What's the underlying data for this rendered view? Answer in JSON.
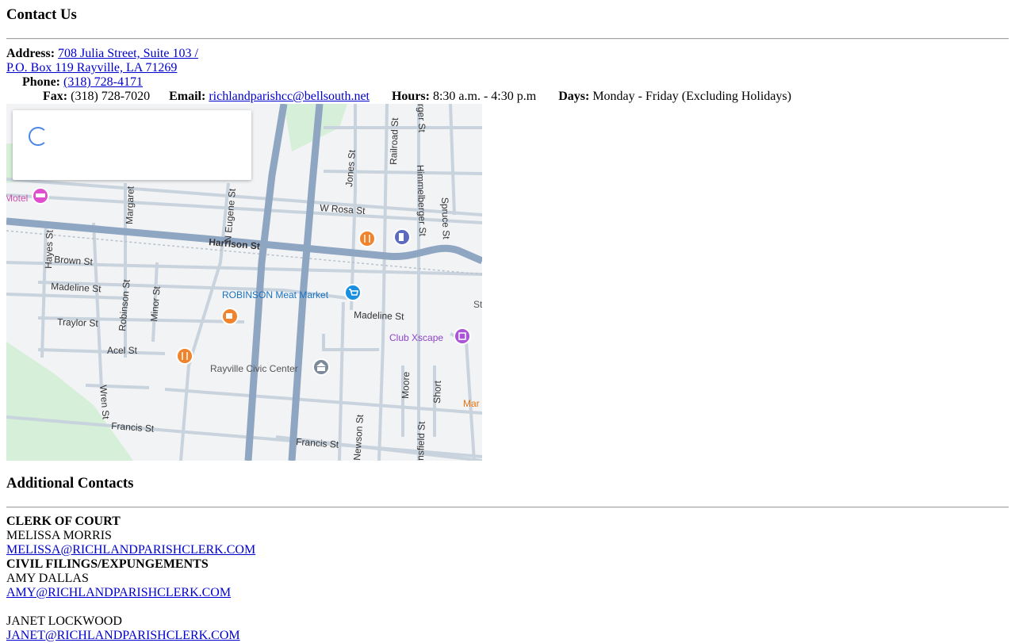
{
  "contact": {
    "title": "Contact Us",
    "address_label": "Address:",
    "address_line1": "708 Julia Street, Suite 103 /",
    "address_line2": "P.O. Box 119 Rayville, LA 71269",
    "phone_label": "Phone:",
    "phone": "(318) 728-4171",
    "fax_label": "Fax:",
    "fax": "(318) 728-7020",
    "email_label": "Email:",
    "email": "richlandparishcc@bellsouth.net",
    "hours_label": "Hours:",
    "hours": "8:30 a.m. - 4:30 p.m",
    "days_label": "Days:",
    "days": "Monday - Friday (Excluding Holidays)"
  },
  "map": {
    "streets": {
      "harrison": "Harrison St",
      "w_rosa": "W Rosa St",
      "brown": "Brown St",
      "madeline_w": "Madeline St",
      "madeline_e": "Madeline St",
      "traylor": "Traylor St",
      "acel": "Acel St",
      "francis_w": "Francis St",
      "francis_e": "Francis St",
      "hayes": "Hayes St",
      "margaret": "Margaret",
      "n_eugene": "N Eugene St",
      "robinson": "Robinson St",
      "minor": "Minor St",
      "wren": "Wren St",
      "jones": "Jones St",
      "railroad": "Railroad St",
      "himmelberger": "Himmelberger St",
      "spruce": "Spruce St",
      "newson": "Newson St",
      "moore": "Moore",
      "short": "Short",
      "mansfield": "nsfield St",
      "burger": "rger St"
    },
    "pois": {
      "motel": "Motel",
      "robinson_market": "ROBINSON Meat Market",
      "club_xscape": "Club Xscape",
      "civic_center": "Rayville Civic Center",
      "mar": "Mar",
      "st_fragment": "St"
    }
  },
  "additional": {
    "title": "Additional Contacts",
    "contacts": [
      {
        "role": "CLERK OF COURT",
        "name": "MELISSA MORRIS",
        "email": "MELISSA@RICHLANDPARISHCLERK.COM"
      },
      {
        "role": "CIVIL FILINGS/EXPUNGEMENTS",
        "name": "AMY DALLAS",
        "email": "AMY@RICHLANDPARISHCLERK.COM"
      },
      {
        "role": "",
        "name": "JANET LOCKWOOD",
        "email": "JANET@RICHLANDPARISHCLERK.COM"
      }
    ]
  },
  "colors": {
    "link": "#0000cc",
    "map_bg": "#f2f3f5",
    "road_major": "#8fa6c2",
    "road_minor": "#c9d3dd",
    "park": "#d6efd8",
    "poi_food": "#f0832b",
    "poi_purple": "#a855d6",
    "poi_blue": "#1a8fe0"
  }
}
